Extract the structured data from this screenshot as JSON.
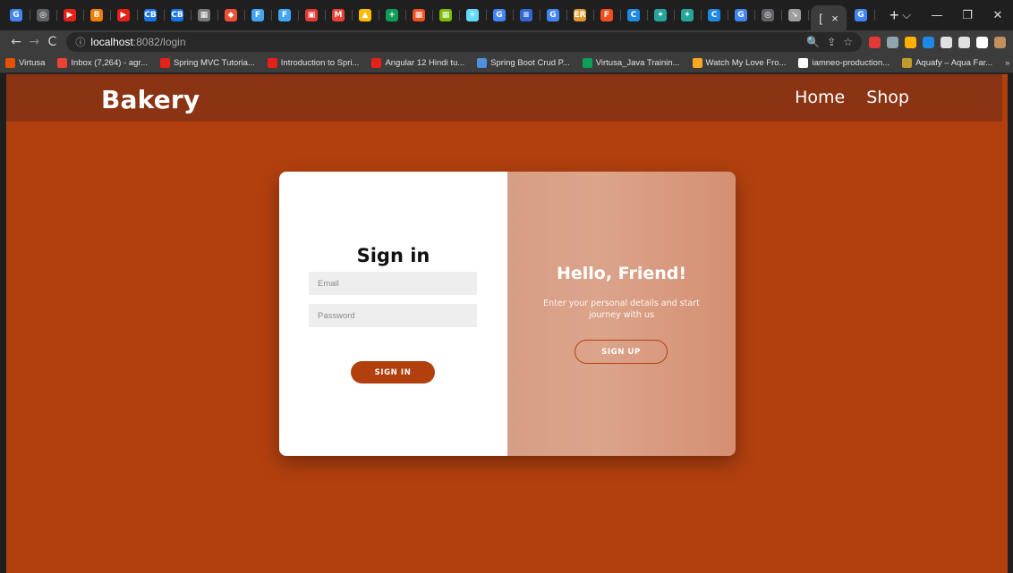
{
  "browser": {
    "tabs": [
      {
        "icon": "google-icon",
        "color": "#4285f4",
        "glyph": "G"
      },
      {
        "icon": "globe-icon",
        "color": "#5f6368",
        "glyph": "◎"
      },
      {
        "icon": "youtube-icon",
        "color": "#e62117",
        "glyph": "▶"
      },
      {
        "icon": "blogger-icon",
        "color": "#f57d00",
        "glyph": "B"
      },
      {
        "icon": "youtube-icon",
        "color": "#e62117",
        "glyph": "▶"
      },
      {
        "icon": "cb-icon",
        "color": "#1a73e8",
        "glyph": "CB"
      },
      {
        "icon": "cb-icon",
        "color": "#1a73e8",
        "glyph": "CB"
      },
      {
        "icon": "app-icon",
        "color": "#7a7a7a",
        "glyph": "▦"
      },
      {
        "icon": "git-icon",
        "color": "#f05033",
        "glyph": "◆"
      },
      {
        "icon": "flutter-icon",
        "color": "#42a5f5",
        "glyph": "F"
      },
      {
        "icon": "flutter-icon",
        "color": "#42a5f5",
        "glyph": "F"
      },
      {
        "icon": "slides-icon",
        "color": "#e53935",
        "glyph": "▣"
      },
      {
        "icon": "gmail-icon",
        "color": "#ea4335",
        "glyph": "M"
      },
      {
        "icon": "drive-icon",
        "color": "#fbbc04",
        "glyph": "▲"
      },
      {
        "icon": "sheets-icon",
        "color": "#0f9d58",
        "glyph": "+"
      },
      {
        "icon": "microsoft-icon",
        "color": "#f25022",
        "glyph": "▦"
      },
      {
        "icon": "microsoft-icon",
        "color": "#7fba00",
        "glyph": "▦"
      },
      {
        "icon": "react-icon",
        "color": "#61dafb",
        "glyph": "✳"
      },
      {
        "icon": "google-icon",
        "color": "#4285f4",
        "glyph": "G"
      },
      {
        "icon": "docs-icon",
        "color": "#3367d6",
        "glyph": "≡"
      },
      {
        "icon": "google-icon",
        "color": "#4285f4",
        "glyph": "G"
      },
      {
        "icon": "er-icon",
        "color": "#e09a2c",
        "glyph": "ER"
      },
      {
        "icon": "figma-icon",
        "color": "#f24e1e",
        "glyph": "F"
      },
      {
        "icon": "cs-icon",
        "color": "#1e88e5",
        "glyph": "C"
      },
      {
        "icon": "compass-icon",
        "color": "#26a69a",
        "glyph": "✦"
      },
      {
        "icon": "compass-icon",
        "color": "#26a69a",
        "glyph": "✦"
      },
      {
        "icon": "cs-icon",
        "color": "#1e88e5",
        "glyph": "C"
      },
      {
        "icon": "google-icon",
        "color": "#4285f4",
        "glyph": "G"
      },
      {
        "icon": "globe-icon",
        "color": "#5f6368",
        "glyph": "◎"
      },
      {
        "icon": "cursor-icon",
        "color": "#9e9e9e",
        "glyph": "➘"
      }
    ],
    "active_tab_close": "×",
    "active_tab_label": "[",
    "new_tab": "+",
    "window_controls": {
      "chevron": "⌵",
      "minimize": "—",
      "restore": "❐",
      "close": "✕"
    },
    "address": {
      "host": "localhost",
      "path": ":8082/login"
    },
    "omni_icons": [
      "🔍",
      "⇪",
      "☆"
    ],
    "extensions": [
      "#e53935",
      "#90a4ae",
      "#ffb300",
      "#1e88e5",
      "#e0e0e0",
      "#e0e0e0",
      "#ffffff",
      "#c0905f"
    ],
    "bookmarks": [
      {
        "label": "Virtusa",
        "color": "#e65100"
      },
      {
        "label": "Inbox (7,264) - agr...",
        "color": "#ea4335"
      },
      {
        "label": "Spring MVC Tutoria...",
        "color": "#e62117"
      },
      {
        "label": "Introduction to Spri...",
        "color": "#e62117"
      },
      {
        "label": "Angular 12 Hindi tu...",
        "color": "#e62117"
      },
      {
        "label": "Spring Boot Crud P...",
        "color": "#4f8fdf"
      },
      {
        "label": "Virtusa_Java Trainin...",
        "color": "#0f9d58"
      },
      {
        "label": "Watch My Love Fro...",
        "color": "#f9a825"
      },
      {
        "label": "iamneo-production...",
        "color": "#ffffff"
      },
      {
        "label": "Aquafy – Aqua Far...",
        "color": "#c49a2c"
      }
    ],
    "bookmarks_more": "»"
  },
  "navbar": {
    "brand": "Bakery",
    "links": [
      "Home",
      "Shop"
    ]
  },
  "signin": {
    "title": "Sign in",
    "email_placeholder": "Email",
    "password_placeholder": "Password",
    "button": "SIGN IN"
  },
  "overlay": {
    "title": "Hello, Friend!",
    "subtitle": "Enter your personal details and start journey with us",
    "button": "SIGN UP"
  },
  "colors": {
    "page_bg": "#b2400f",
    "navbar_bg": "#8a3414",
    "accent": "#b2400f"
  }
}
